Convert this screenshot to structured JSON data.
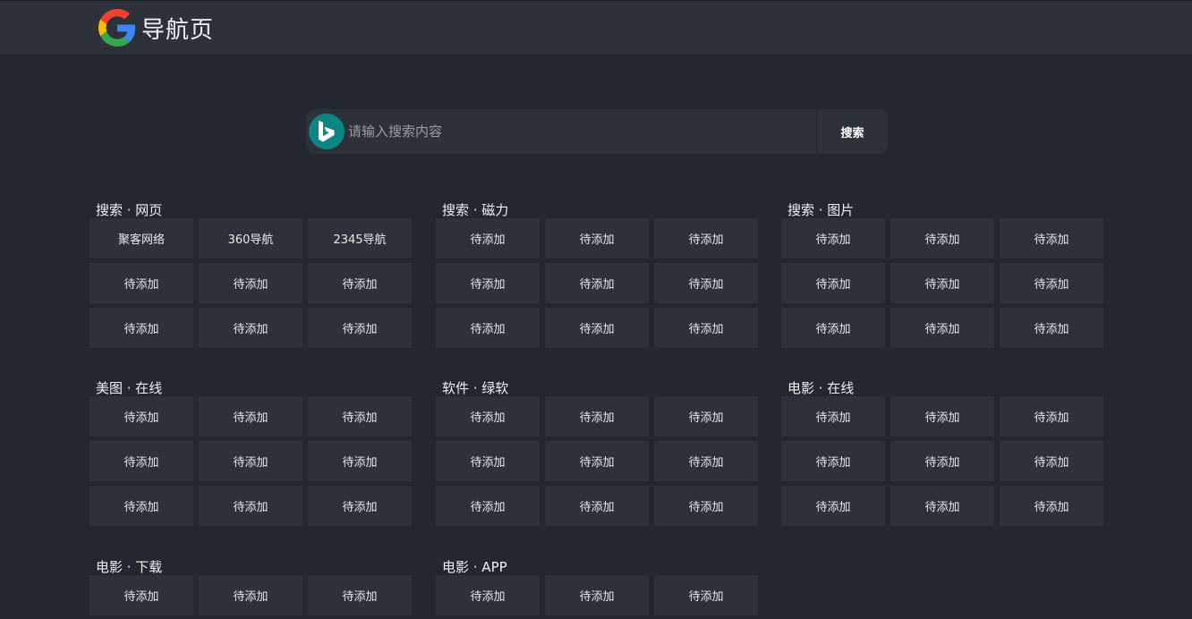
{
  "header": {
    "title": "导航页",
    "logo_icon": "google-g-icon"
  },
  "search": {
    "engine_icon": "bing-icon",
    "placeholder": "请输入搜索内容",
    "value": "",
    "button_label": "搜索"
  },
  "groups": [
    {
      "title": "搜索 · 网页",
      "items": [
        "聚客网络",
        "360导航",
        "2345导航",
        "待添加",
        "待添加",
        "待添加",
        "待添加",
        "待添加",
        "待添加"
      ]
    },
    {
      "title": "搜索 · 磁力",
      "items": [
        "待添加",
        "待添加",
        "待添加",
        "待添加",
        "待添加",
        "待添加",
        "待添加",
        "待添加",
        "待添加"
      ]
    },
    {
      "title": "搜索 · 图片",
      "items": [
        "待添加",
        "待添加",
        "待添加",
        "待添加",
        "待添加",
        "待添加",
        "待添加",
        "待添加",
        "待添加"
      ]
    },
    {
      "title": "美图 · 在线",
      "items": [
        "待添加",
        "待添加",
        "待添加",
        "待添加",
        "待添加",
        "待添加",
        "待添加",
        "待添加",
        "待添加"
      ]
    },
    {
      "title": "软件 · 绿软",
      "items": [
        "待添加",
        "待添加",
        "待添加",
        "待添加",
        "待添加",
        "待添加",
        "待添加",
        "待添加",
        "待添加"
      ]
    },
    {
      "title": "电影 · 在线",
      "items": [
        "待添加",
        "待添加",
        "待添加",
        "待添加",
        "待添加",
        "待添加",
        "待添加",
        "待添加",
        "待添加"
      ]
    },
    {
      "title": "电影 · 下载",
      "items": [
        "待添加",
        "待添加",
        "待添加"
      ]
    },
    {
      "title": "电影 · APP",
      "items": [
        "待添加",
        "待添加",
        "待添加"
      ]
    }
  ],
  "colors": {
    "background": "#23272f",
    "panel": "#2d313a",
    "bing_teal": "#0e8585"
  }
}
